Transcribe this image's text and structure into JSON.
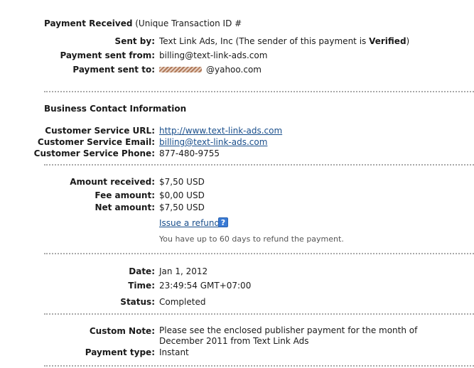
{
  "header": {
    "title": "Payment Received",
    "transaction_label": "(Unique Transaction ID #"
  },
  "sender": {
    "sent_by_label": "Sent by:",
    "sent_by_value": "Text Link Ads, Inc (The sender of this payment is",
    "sent_by_verified": "Verified",
    "sent_by_close": ")",
    "sent_from_label": "Payment sent from:",
    "sent_from_value": "billing@text-link-ads.com",
    "sent_to_label": "Payment sent to:",
    "sent_to_value": "@yahoo.com"
  },
  "business": {
    "title": "Business Contact Information",
    "url_label": "Customer Service URL:",
    "url_value": "http://www.text-link-ads.com",
    "email_label": "Customer Service Email:",
    "email_value": "billing@text-link-ads.com",
    "phone_label": "Customer Service Phone:",
    "phone_value": "877-480-9755"
  },
  "amounts": {
    "received_label": "Amount received:",
    "received_value": "$7,50 USD",
    "fee_label": "Fee amount:",
    "fee_value": "$0,00 USD",
    "net_label": "Net amount:",
    "net_value": "$7,50 USD",
    "refund_link": "Issue a refund",
    "refund_help": "?",
    "refund_note": "You have up to 60 days to refund the payment."
  },
  "timing": {
    "date_label": "Date:",
    "date_value": "Jan 1, 2012",
    "time_label": "Time:",
    "time_value": "23:49:54 GMT+07:00",
    "status_label": "Status:",
    "status_value": "Completed"
  },
  "note": {
    "custom_label": "Custom Note:",
    "custom_value": "Please see the enclosed publisher payment for the month of December 2011 from Text Link Ads",
    "type_label": "Payment type:",
    "type_value": "Instant"
  }
}
